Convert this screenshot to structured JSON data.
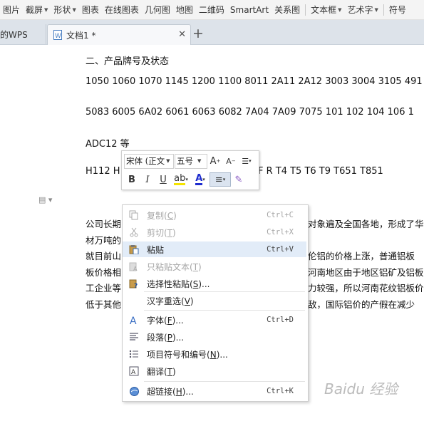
{
  "ribbon": {
    "items": [
      {
        "label": "图片",
        "caret": false
      },
      {
        "label": "截屏",
        "caret": true
      },
      {
        "label": "形状",
        "caret": true
      },
      {
        "label": "图表",
        "caret": false
      },
      {
        "label": "在线图表",
        "caret": false
      },
      {
        "label": "几何图",
        "caret": false
      },
      {
        "label": "地图",
        "caret": false
      },
      {
        "label": "二维码",
        "caret": false
      },
      {
        "label": "SmartArt",
        "caret": false
      },
      {
        "label": "关系图",
        "caret": false
      },
      {
        "label": "文本框",
        "caret": true
      },
      {
        "label": "艺术字",
        "caret": true
      },
      {
        "label": "符号",
        "caret": false
      }
    ]
  },
  "tabs": {
    "first": "的WPS",
    "active": "文档1 *"
  },
  "doc": {
    "heading": "二、产品牌号及状态",
    "line1": "1050 1060 1070 1145 1200 1100 8011 2A11 2A12 3003 3004 3105 491",
    "line2": "5083 6005 6A02 6061 6063 6082 7A04 7A09 7075 101 102 104 106 1",
    "line3": "ADC12 等",
    "line4_left": "H112 H",
    "line4_right": "F R T4 T5 T6 T9 T651 T851",
    "para": [
      {
        "left": "公司长期",
        "right": "对象遍及全国各地，形成了华"
      },
      {
        "left": "材万吨的",
        "right": ""
      },
      {
        "left": "就目前山",
        "right": "伦铝的价格上涨，普通铝板"
      },
      {
        "left": "板价格相",
        "right": "河南地区由于地区铝矿及铝板"
      },
      {
        "left": "工企业等",
        "right": "力较强，所以河南花纹铝板价"
      },
      {
        "left": "低于其他",
        "right": "敌，国际铝价的产假在减少"
      }
    ]
  },
  "minitoolbar": {
    "font": "宋体 (正文",
    "size": "五号",
    "colors": {
      "highlight": "#f5e400",
      "fontcolor": "#1e2ccf"
    }
  },
  "context_menu": {
    "items": [
      {
        "label": "复制",
        "key": "C",
        "shortcut": "Ctrl+C",
        "disabled": true,
        "icon": "copy-icon"
      },
      {
        "label": "剪切",
        "key": "T",
        "shortcut": "Ctrl+X",
        "disabled": true,
        "icon": "scissors-icon"
      },
      {
        "label": "粘贴",
        "key": "",
        "shortcut": "Ctrl+V",
        "disabled": false,
        "highlight": true,
        "icon": "paste-icon"
      },
      {
        "label": "只粘贴文本",
        "key": "T",
        "shortcut": "",
        "disabled": true,
        "icon": "paste-text-icon"
      },
      {
        "label": "选择性粘贴",
        "key": "S",
        "suffix": "...",
        "shortcut": "",
        "disabled": false,
        "icon": "paste-special-icon"
      },
      {
        "label": "汉字重选",
        "key": "V",
        "shortcut": "",
        "disabled": false,
        "icon": ""
      },
      {
        "label": "字体",
        "key": "F",
        "suffix": "...",
        "shortcut": "Ctrl+D",
        "disabled": false,
        "icon": "font-icon"
      },
      {
        "label": "段落",
        "key": "P",
        "suffix": "...",
        "shortcut": "",
        "disabled": false,
        "icon": "paragraph-icon"
      },
      {
        "label": "项目符号和编号",
        "key": "N",
        "suffix": "...",
        "shortcut": "",
        "disabled": false,
        "icon": "bullets-icon"
      },
      {
        "label": "翻译",
        "key": "T",
        "shortcut": "",
        "disabled": false,
        "icon": "translate-icon"
      },
      {
        "label": "超链接",
        "key": "H",
        "suffix": "...",
        "shortcut": "Ctrl+K",
        "disabled": false,
        "icon": "hyperlink-icon"
      }
    ]
  },
  "watermark": "Baidu 经验"
}
